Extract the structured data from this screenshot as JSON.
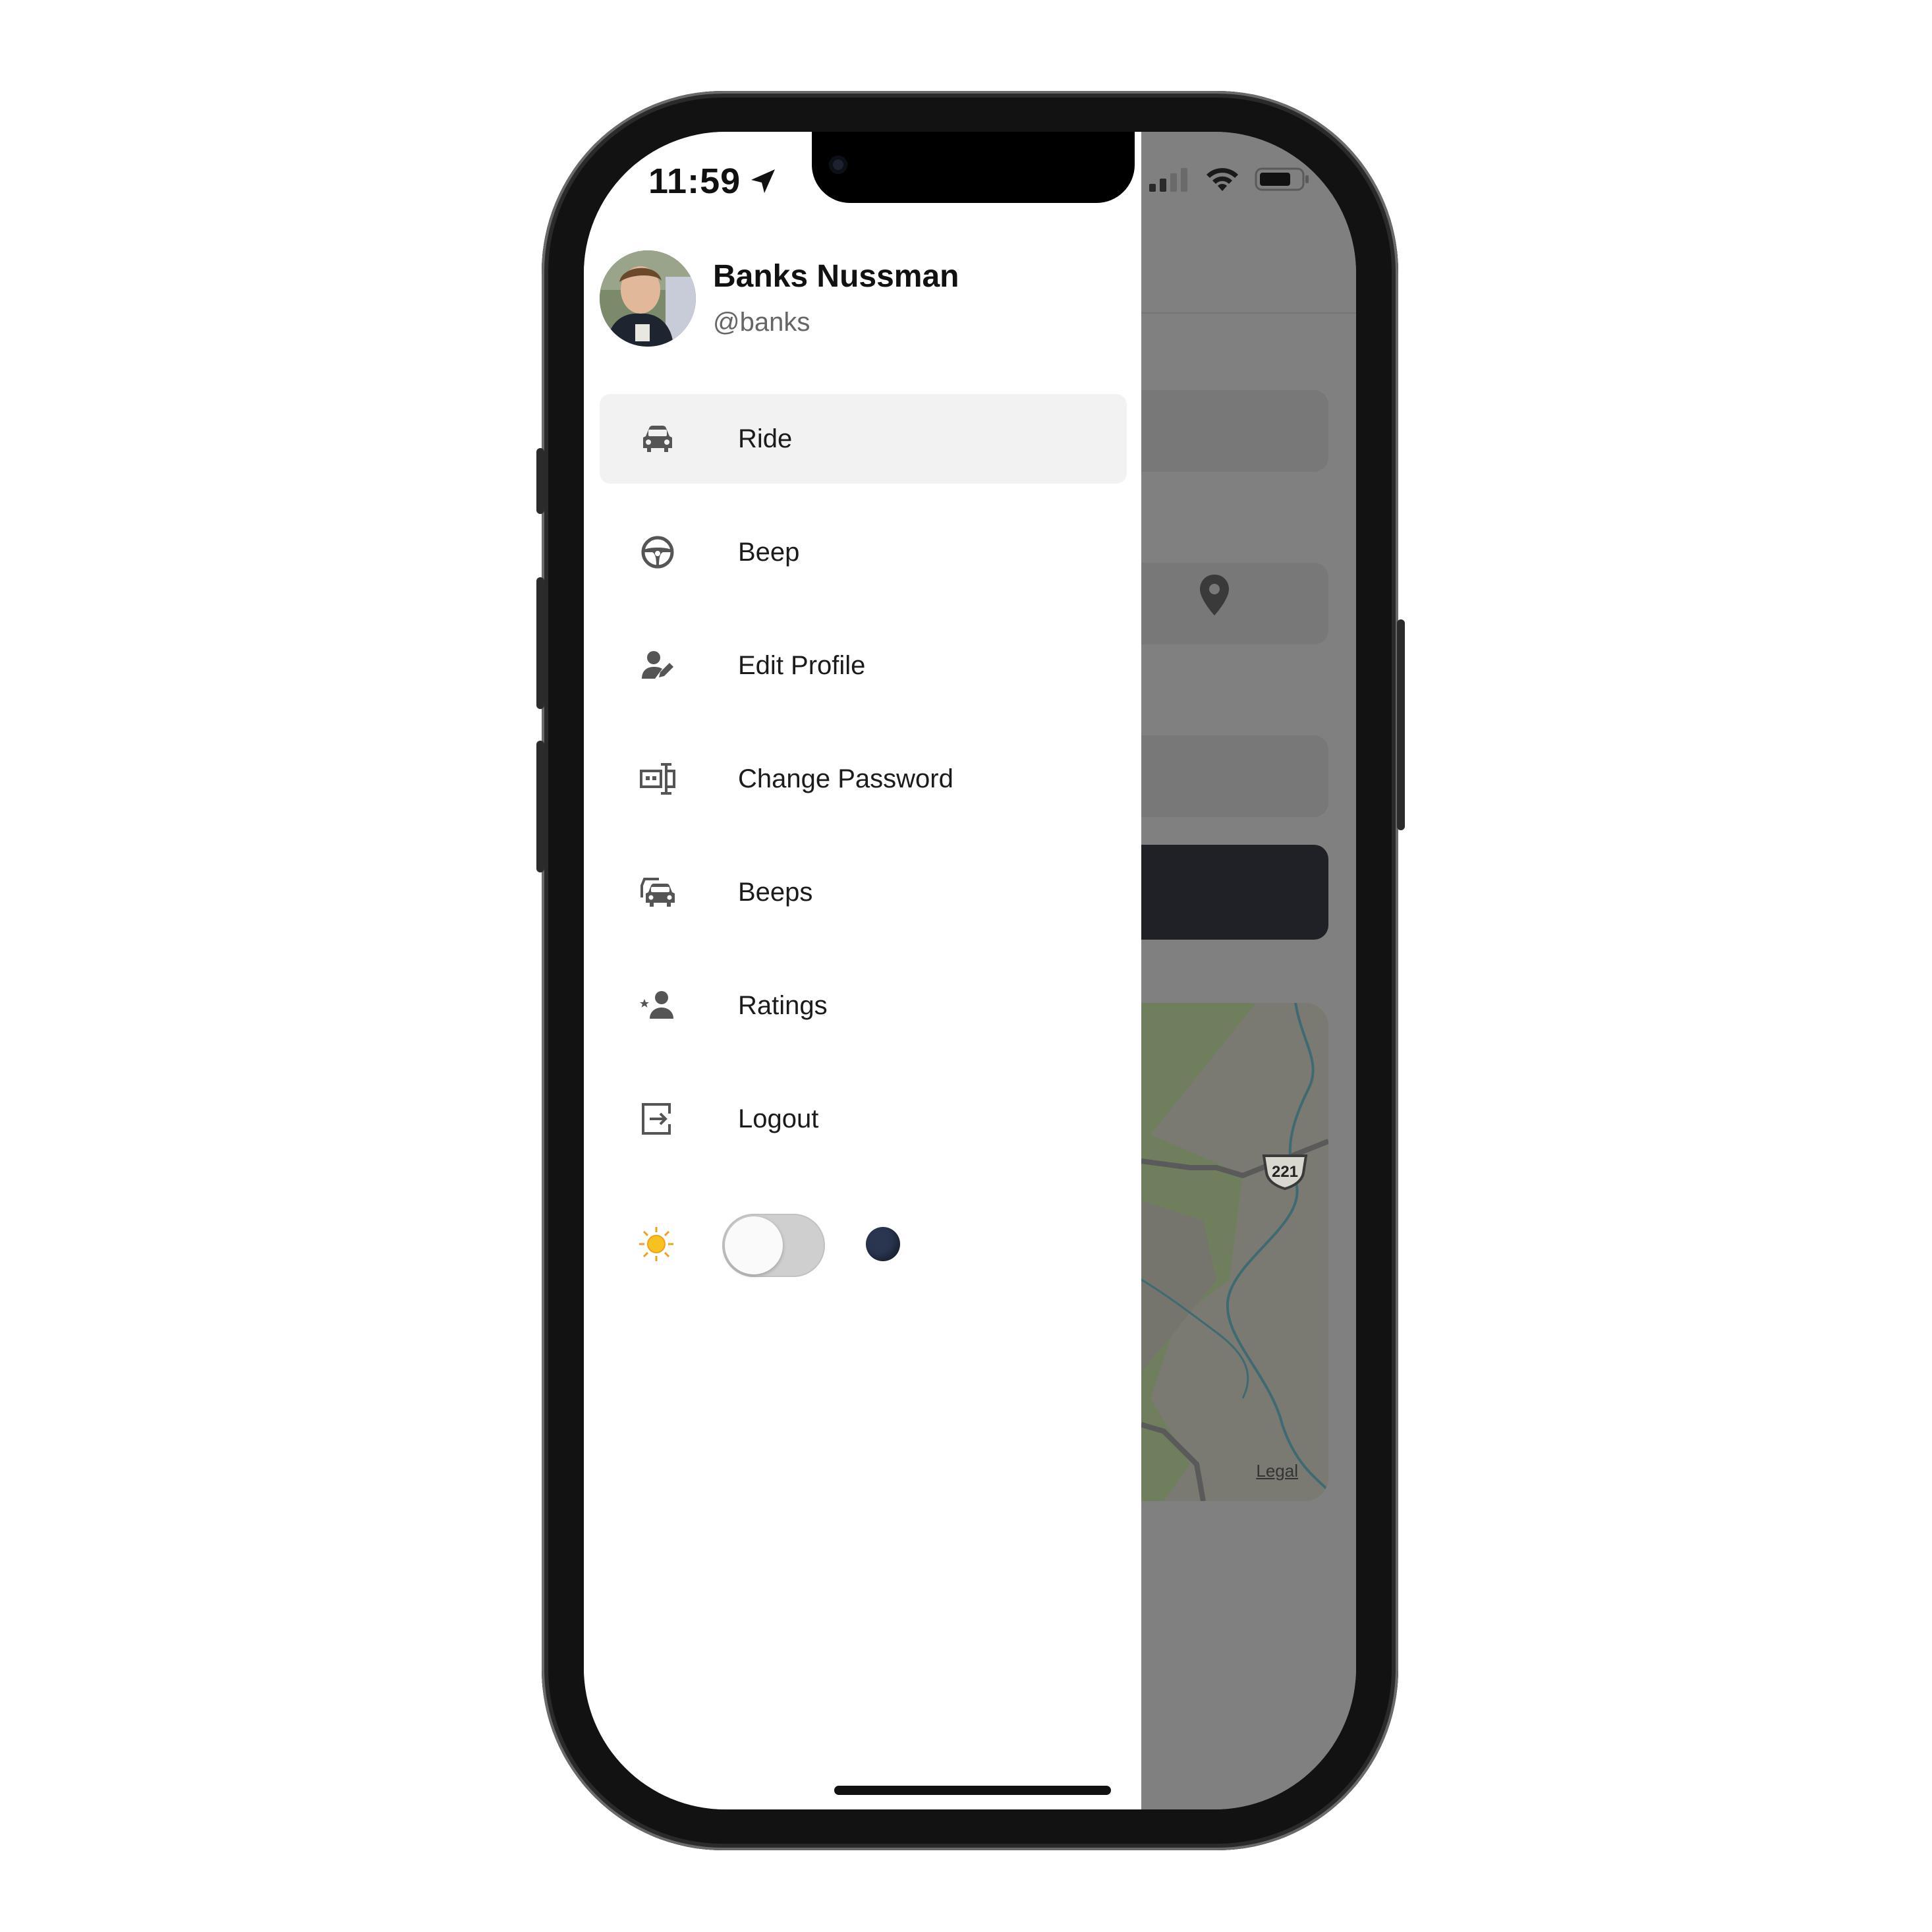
{
  "status_bar": {
    "time": "11:59"
  },
  "profile": {
    "name": "Banks Nussman",
    "username": "@banks"
  },
  "menu": {
    "items": [
      {
        "label": "Ride",
        "icon": "car-icon",
        "active": true
      },
      {
        "label": "Beep",
        "icon": "steering-wheel-icon",
        "active": false
      },
      {
        "label": "Edit Profile",
        "icon": "edit-person-icon",
        "active": false
      },
      {
        "label": "Change Password",
        "icon": "password-icon",
        "active": false
      },
      {
        "label": "Beeps",
        "icon": "cars-icon",
        "active": false
      },
      {
        "label": "Ratings",
        "icon": "rated-person-icon",
        "active": false
      },
      {
        "label": "Logout",
        "icon": "logout-icon",
        "active": false
      }
    ]
  },
  "theme_toggle": {
    "dark_mode": false,
    "light_icon": "sun-icon",
    "dark_icon": "moon-icon"
  },
  "background_app": {
    "map_legal": "Legal",
    "route_number": "221"
  },
  "colors": {
    "active_item_bg": "#f2f2f2",
    "overlay": "#808080",
    "button_dark": "#1f2126",
    "icon_gray": "#555555"
  }
}
